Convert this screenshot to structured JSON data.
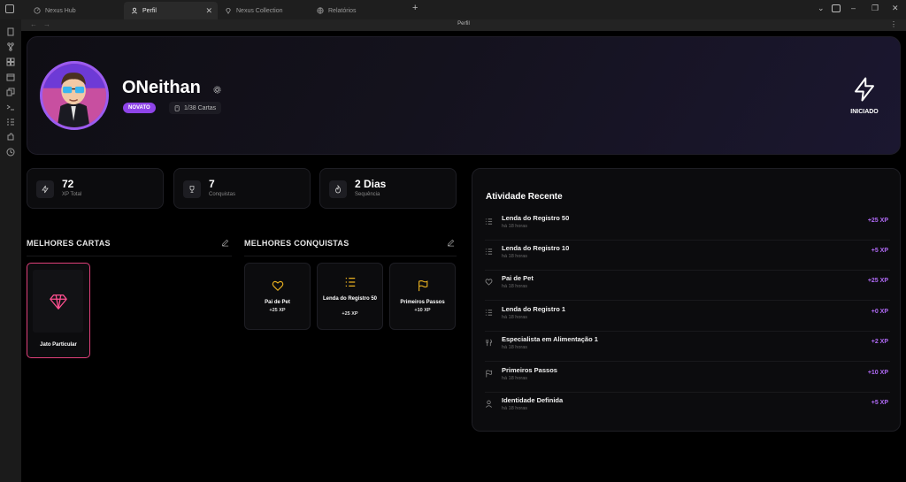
{
  "browser": {
    "tabs": [
      {
        "label": "Nexus Hub",
        "icon": "dashboard-icon"
      },
      {
        "label": "Perfil",
        "icon": "user-icon",
        "active": true
      },
      {
        "label": "Nexus Collection",
        "icon": "gem-icon"
      },
      {
        "label": "Relatórios",
        "icon": "globe-icon"
      }
    ],
    "page_title": "Perfil"
  },
  "profile": {
    "username": "ONeithan",
    "badge": "NOVATO",
    "cards": "1/38 Cartas",
    "rank_label": "INICIADO"
  },
  "stats": [
    {
      "value": "72",
      "label": "XP Total",
      "icon": "bolt-icon"
    },
    {
      "value": "7",
      "label": "Conquistas",
      "icon": "trophy-icon"
    },
    {
      "value": "2 Dias",
      "label": "Sequência",
      "icon": "flame-icon"
    }
  ],
  "best_cards": {
    "title": "MELHORES CARTAS",
    "items": [
      {
        "name": "Jato Particular",
        "icon": "diamond-icon",
        "color": "#e0407a"
      }
    ]
  },
  "best_achievements": {
    "title": "MELHORES CONQUISTAS",
    "items": [
      {
        "name": "Pai de Pet",
        "xp": "+25 XP",
        "icon": "heart-icon"
      },
      {
        "name": "Lenda do Registro 50",
        "xp": "+25 XP",
        "icon": "list-icon"
      },
      {
        "name": "Primeiros Passos",
        "xp": "+10 XP",
        "icon": "flag-icon"
      }
    ]
  },
  "activity": {
    "title": "Atividade Recente",
    "items": [
      {
        "name": "Lenda do Registro 50",
        "time": "há 18 horas",
        "xp": "+25 XP",
        "icon": "list-icon"
      },
      {
        "name": "Lenda do Registro 10",
        "time": "há 18 horas",
        "xp": "+5 XP",
        "icon": "list-icon"
      },
      {
        "name": "Pai de Pet",
        "time": "há 18 horas",
        "xp": "+25 XP",
        "icon": "heart-icon"
      },
      {
        "name": "Lenda do Registro 1",
        "time": "há 18 horas",
        "xp": "+0 XP",
        "icon": "list-icon"
      },
      {
        "name": "Especialista em Alimentação 1",
        "time": "há 18 horas",
        "xp": "+2 XP",
        "icon": "utensils-icon"
      },
      {
        "name": "Primeiros Passos",
        "time": "há 18 horas",
        "xp": "+10 XP",
        "icon": "flag-icon"
      },
      {
        "name": "Identidade Definida",
        "time": "há 18 horas",
        "xp": "+5 XP",
        "icon": "user-icon"
      }
    ]
  },
  "colors": {
    "accent": "#8e44e8",
    "xp": "#b06af5",
    "gold": "#e8b020",
    "card_border": "#e0407a"
  }
}
